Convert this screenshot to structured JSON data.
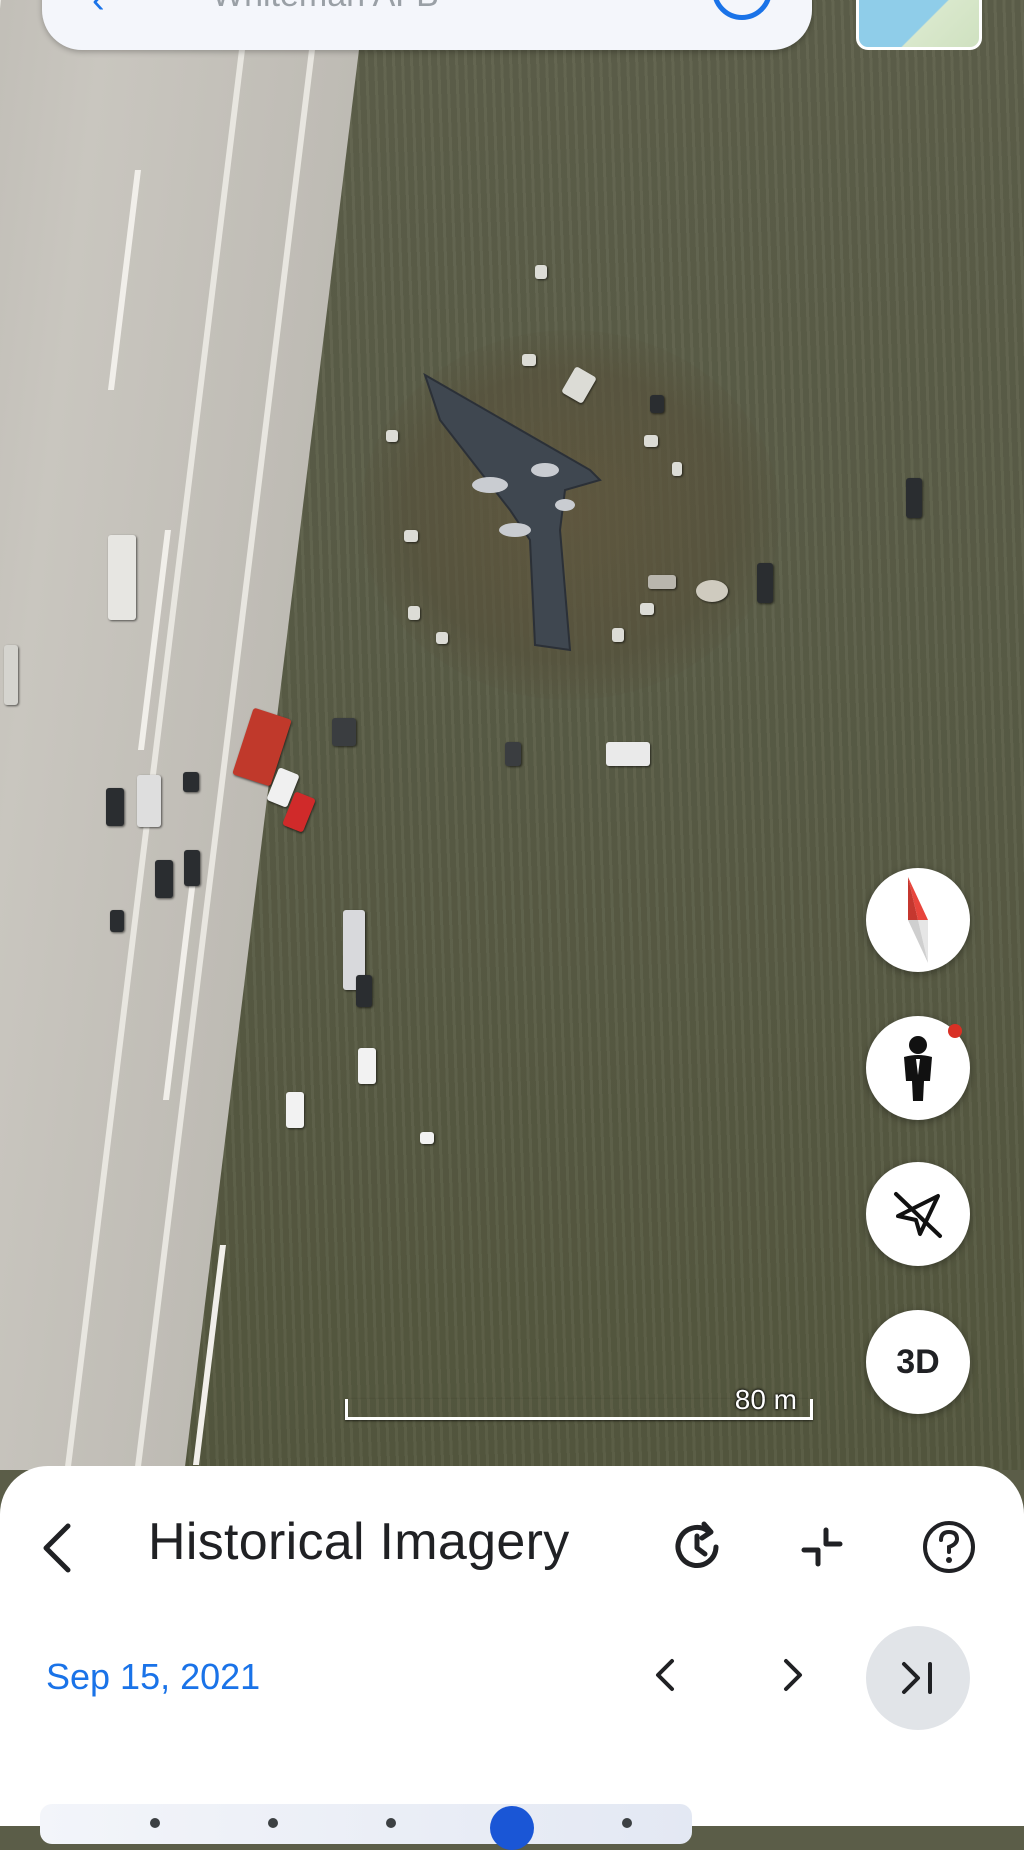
{
  "search": {
    "query": "Whiteman AFB"
  },
  "map": {
    "scale_label": "80 m"
  },
  "map_controls": {
    "compass_icon": "compass-icon",
    "street_view_icon": "pegman-icon",
    "satellite_toggle_icon": "satellite-off-icon",
    "three_d_label": "3D"
  },
  "historical_panel": {
    "title": "Historical Imagery",
    "date": "Sep 15, 2021",
    "icons": [
      "back-icon",
      "history-icon",
      "collapse-icon",
      "help-icon",
      "chevron-left-icon",
      "chevron-right-icon",
      "skip-to-latest-icon"
    ]
  },
  "colors": {
    "accent": "#1a73e8",
    "slider_thumb": "#1a56d6",
    "notification": "#d93025"
  }
}
